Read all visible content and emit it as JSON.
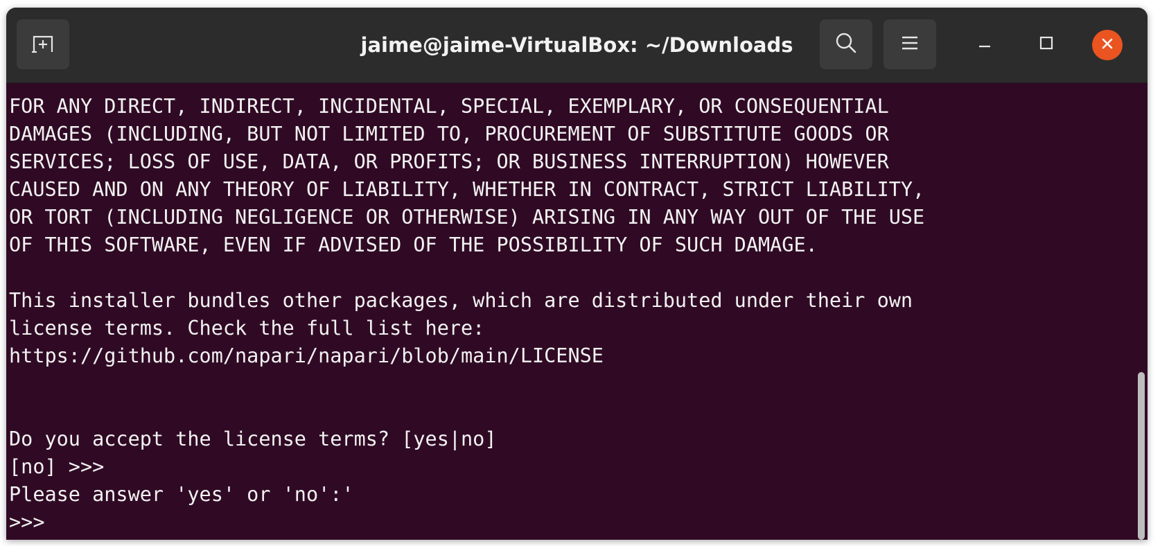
{
  "window": {
    "title": "jaime@jaime-VirtualBox: ~/Downloads"
  },
  "titlebar": {
    "new_tab_icon": "new-tab-icon",
    "search_icon": "search-icon",
    "menu_icon": "hamburger-menu-icon",
    "minimize_icon": "minimize-icon",
    "maximize_icon": "maximize-icon",
    "close_icon": "close-icon"
  },
  "colors": {
    "terminal_bg": "#300a24",
    "titlebar_bg": "#2c2c2c",
    "close_accent": "#e95420",
    "text": "#f2f2f2"
  },
  "terminal": {
    "lines": [
      "FOR ANY DIRECT, INDIRECT, INCIDENTAL, SPECIAL, EXEMPLARY, OR CONSEQUENTIAL",
      "DAMAGES (INCLUDING, BUT NOT LIMITED TO, PROCUREMENT OF SUBSTITUTE GOODS OR",
      "SERVICES; LOSS OF USE, DATA, OR PROFITS; OR BUSINESS INTERRUPTION) HOWEVER",
      "CAUSED AND ON ANY THEORY OF LIABILITY, WHETHER IN CONTRACT, STRICT LIABILITY,",
      "OR TORT (INCLUDING NEGLIGENCE OR OTHERWISE) ARISING IN ANY WAY OUT OF THE USE",
      "OF THIS SOFTWARE, EVEN IF ADVISED OF THE POSSIBILITY OF SUCH DAMAGE.",
      "",
      "This installer bundles other packages, which are distributed under their own",
      "license terms. Check the full list here:",
      "https://github.com/napari/napari/blob/main/LICENSE",
      "",
      "",
      "Do you accept the license terms? [yes|no]",
      "[no] >>> ",
      "Please answer 'yes' or 'no':'",
      ">>> "
    ]
  }
}
